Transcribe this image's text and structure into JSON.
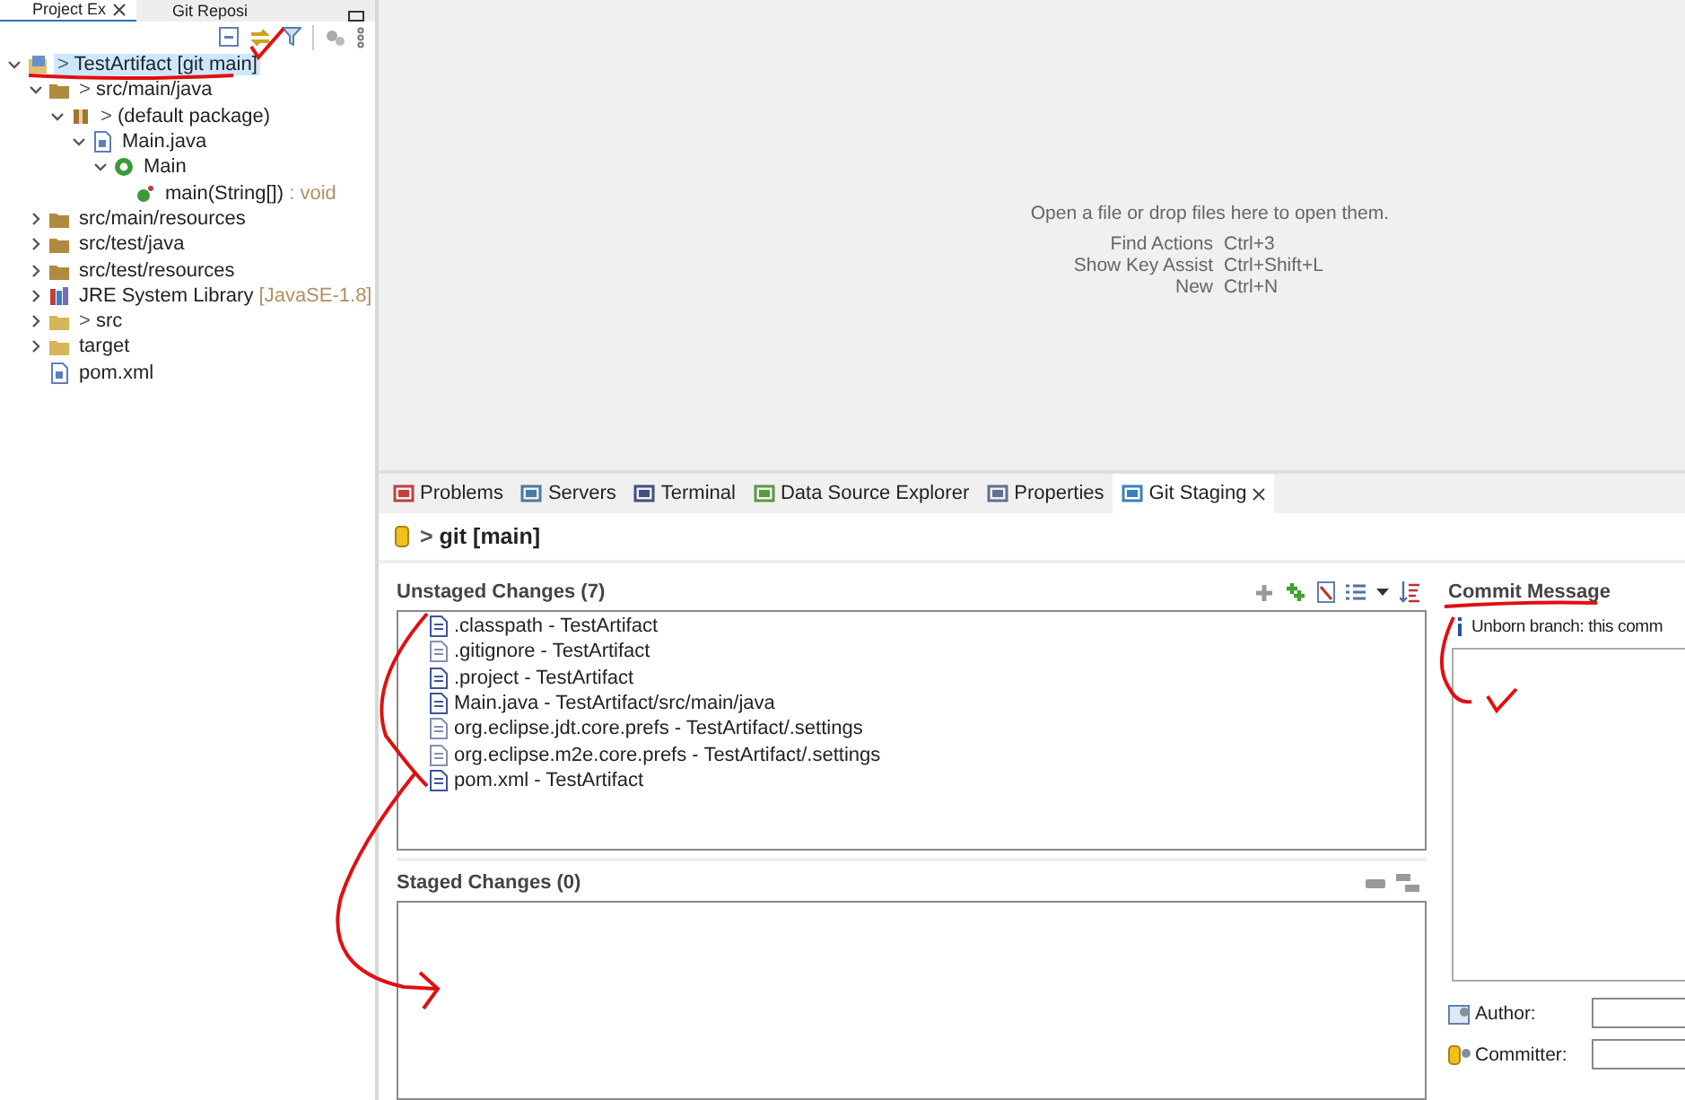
{
  "left_tabs": [
    {
      "label": "Project Ex",
      "selected": true
    },
    {
      "label": "Git Reposi",
      "selected": false
    }
  ],
  "tree": [
    {
      "prefix": ">",
      "label": "TestArtifact",
      "decoration": "[git main]",
      "kind": "project",
      "expanded": true,
      "selected": true,
      "children": [
        {
          "prefix": ">",
          "label": "src/main/java",
          "kind": "source-folder",
          "expanded": true,
          "selected": false,
          "children": [
            {
              "prefix": ">",
              "label": "(default package)",
              "kind": "package",
              "expanded": true,
              "selected": false,
              "children": [
                {
                  "label": "Main.java",
                  "kind": "java-file",
                  "expanded": true,
                  "selected": false,
                  "children": [
                    {
                      "label": "Main",
                      "kind": "class",
                      "expanded": true,
                      "selected": false,
                      "children": [
                        {
                          "label": "main(String[])",
                          "decoration": ": void",
                          "kind": "method",
                          "selected": false
                        }
                      ]
                    }
                  ]
                }
              ]
            }
          ]
        },
        {
          "label": "src/main/resources",
          "kind": "source-folder",
          "expanded": false,
          "selected": false
        },
        {
          "label": "src/test/java",
          "kind": "source-folder",
          "expanded": false,
          "selected": false
        },
        {
          "label": "src/test/resources",
          "kind": "source-folder",
          "expanded": false,
          "selected": false
        },
        {
          "label": "JRE System Library",
          "decoration": "[JavaSE-1.8]",
          "kind": "library",
          "expanded": false,
          "selected": false
        },
        {
          "prefix": ">",
          "label": "src",
          "kind": "folder",
          "expanded": false,
          "selected": false
        },
        {
          "label": "target",
          "kind": "folder",
          "expanded": false,
          "selected": false
        },
        {
          "label": "pom.xml",
          "kind": "xml-file",
          "selected": false
        }
      ]
    }
  ],
  "editor": {
    "hint": "Open a file or drop files here to open them.",
    "shortcuts": [
      {
        "action": "Find Actions",
        "keys": "Ctrl+3"
      },
      {
        "action": "Show Key Assist",
        "keys": "Ctrl+Shift+L"
      },
      {
        "action": "New",
        "keys": "Ctrl+N"
      }
    ]
  },
  "bottom_tabs": [
    {
      "label": "Problems",
      "kind": "problems",
      "selected": false
    },
    {
      "label": "Servers",
      "kind": "servers",
      "selected": false
    },
    {
      "label": "Terminal",
      "kind": "terminal",
      "selected": false
    },
    {
      "label": "Data Source Explorer",
      "kind": "datasource",
      "selected": false
    },
    {
      "label": "Properties",
      "kind": "properties",
      "selected": false
    },
    {
      "label": "Git Staging",
      "kind": "staging",
      "selected": true
    }
  ],
  "staging": {
    "prefix": ">",
    "repository": "git [main]",
    "unstaged": {
      "title": "Unstaged Changes (7)",
      "files": [
        {
          "label": ".classpath - TestArtifact",
          "kind": "xml"
        },
        {
          "label": ".gitignore - TestArtifact",
          "kind": "text"
        },
        {
          "label": ".project - TestArtifact",
          "kind": "xml"
        },
        {
          "label": "Main.java - TestArtifact/src/main/java",
          "kind": "java"
        },
        {
          "label": "org.eclipse.jdt.core.prefs - TestArtifact/.settings",
          "kind": "text"
        },
        {
          "label": "org.eclipse.m2e.core.prefs - TestArtifact/.settings",
          "kind": "text"
        },
        {
          "label": "pom.xml - TestArtifact",
          "kind": "pom"
        }
      ]
    },
    "staged": {
      "title": "Staged Changes (0)"
    },
    "commit": {
      "title": "Commit Message",
      "info": "Unborn branch: this comm",
      "author_label": "Author:",
      "committer_label": "Committer:"
    }
  }
}
